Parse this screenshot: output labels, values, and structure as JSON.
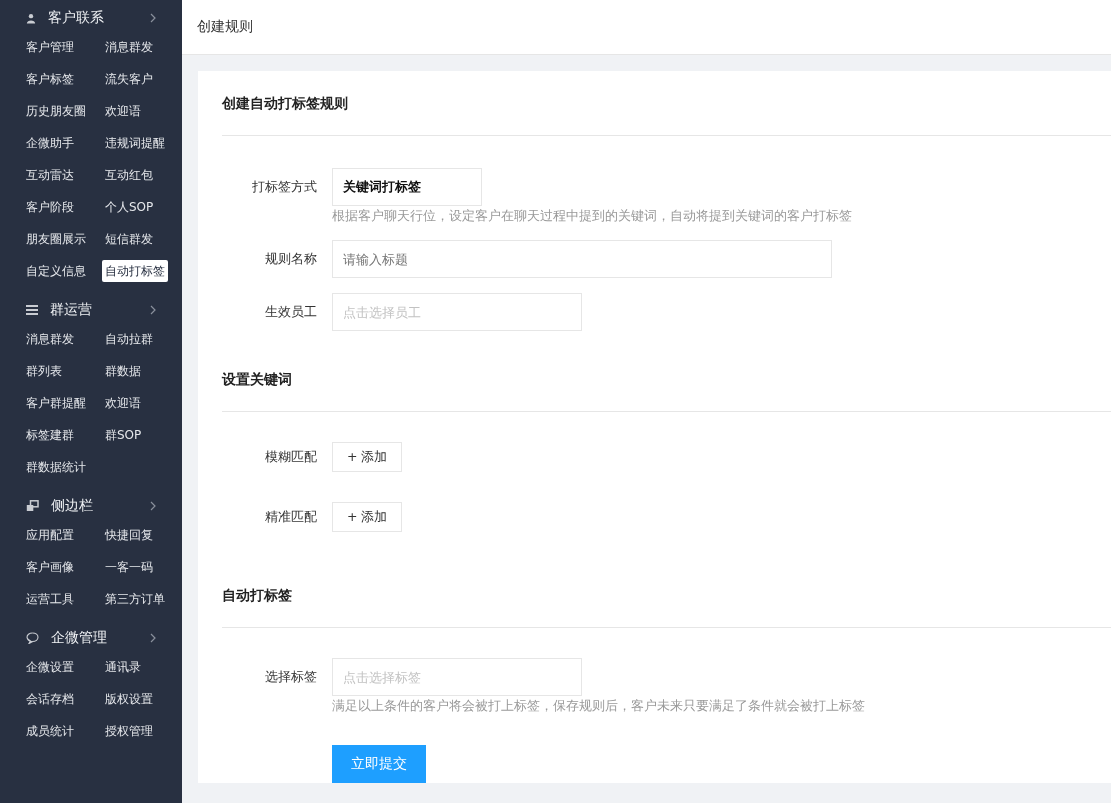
{
  "sidebar": {
    "groups": [
      {
        "title": "客户联系",
        "items": [
          {
            "label": "客户管理",
            "selected": false
          },
          {
            "label": "消息群发",
            "selected": false
          },
          {
            "label": "客户标签",
            "selected": false
          },
          {
            "label": "流失客户",
            "selected": false
          },
          {
            "label": "历史朋友圈",
            "selected": false
          },
          {
            "label": "欢迎语",
            "selected": false
          },
          {
            "label": "企微助手",
            "selected": false
          },
          {
            "label": "违规词提醒",
            "selected": false
          },
          {
            "label": "互动雷达",
            "selected": false
          },
          {
            "label": "互动红包",
            "selected": false
          },
          {
            "label": "客户阶段",
            "selected": false
          },
          {
            "label": "个人SOP",
            "selected": false
          },
          {
            "label": "朋友圈展示",
            "selected": false
          },
          {
            "label": "短信群发",
            "selected": false
          },
          {
            "label": "自定义信息",
            "selected": false
          },
          {
            "label": "自动打标签",
            "selected": true
          }
        ]
      },
      {
        "title": "群运营",
        "items": [
          {
            "label": "消息群发",
            "selected": false
          },
          {
            "label": "自动拉群",
            "selected": false
          },
          {
            "label": "群列表",
            "selected": false
          },
          {
            "label": "群数据",
            "selected": false
          },
          {
            "label": "客户群提醒",
            "selected": false
          },
          {
            "label": "欢迎语",
            "selected": false
          },
          {
            "label": "标签建群",
            "selected": false
          },
          {
            "label": "群SOP",
            "selected": false
          },
          {
            "label": "群数据统计",
            "selected": false
          }
        ]
      },
      {
        "title": "侧边栏",
        "items": [
          {
            "label": "应用配置",
            "selected": false
          },
          {
            "label": "快捷回复",
            "selected": false
          },
          {
            "label": "客户画像",
            "selected": false
          },
          {
            "label": "一客一码",
            "selected": false
          },
          {
            "label": "运营工具",
            "selected": false
          },
          {
            "label": "第三方订单",
            "selected": false
          }
        ]
      },
      {
        "title": "企微管理",
        "items": [
          {
            "label": "企微设置",
            "selected": false
          },
          {
            "label": "通讯录",
            "selected": false
          },
          {
            "label": "会话存档",
            "selected": false
          },
          {
            "label": "版权设置",
            "selected": false
          },
          {
            "label": "成员统计",
            "selected": false
          },
          {
            "label": "授权管理",
            "selected": false
          }
        ]
      }
    ]
  },
  "header": {
    "title": "创建规则"
  },
  "sections": [
    {
      "title": "创建自动打标签规则",
      "rows": [
        {
          "kind": "select",
          "label": "打标签方式",
          "value": "关键词打标签",
          "hint": "根据客户聊天行位，设定客户在聊天过程中提到的关键词，自动将提到关键词的客户打标签"
        },
        {
          "kind": "text",
          "label": "规则名称",
          "placeholder": "请输入标题"
        },
        {
          "kind": "picker",
          "label": "生效员工",
          "placeholder": "点击选择员工"
        }
      ]
    },
    {
      "title": "设置关键词",
      "rows": [
        {
          "kind": "add",
          "label": "模糊匹配",
          "button": "+ 添加"
        },
        {
          "kind": "add",
          "label": "精准匹配",
          "button": "+ 添加"
        }
      ]
    },
    {
      "title": "自动打标签",
      "rows": [
        {
          "kind": "picker",
          "label": "选择标签",
          "placeholder": "点击选择标签",
          "hint": "满足以上条件的客户将会被打上标签，保存规则后，客户未来只要满足了条件就会被打上标签"
        }
      ]
    }
  ],
  "submit": "立即提交"
}
